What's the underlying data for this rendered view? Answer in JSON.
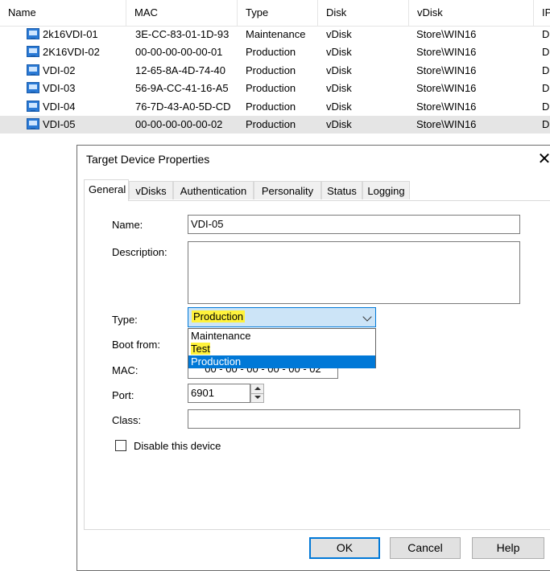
{
  "list": {
    "columns": [
      "Name",
      "MAC",
      "Type",
      "Disk",
      "vDisk",
      "IP"
    ],
    "rows": [
      {
        "name": "2k16VDI-01",
        "mac": "3E-CC-83-01-1D-93",
        "type": "Maintenance",
        "disk": "vDisk",
        "vdisk": "Store\\WIN16",
        "ip": "D"
      },
      {
        "name": "2K16VDI-02",
        "mac": "00-00-00-00-00-01",
        "type": "Production",
        "disk": "vDisk",
        "vdisk": "Store\\WIN16",
        "ip": "D"
      },
      {
        "name": "VDI-02",
        "mac": "12-65-8A-4D-74-40",
        "type": "Production",
        "disk": "vDisk",
        "vdisk": "Store\\WIN16",
        "ip": "D"
      },
      {
        "name": "VDI-03",
        "mac": "56-9A-CC-41-16-A5",
        "type": "Production",
        "disk": "vDisk",
        "vdisk": "Store\\WIN16",
        "ip": "D"
      },
      {
        "name": "VDI-04",
        "mac": "76-7D-43-A0-5D-CD",
        "type": "Production",
        "disk": "vDisk",
        "vdisk": "Store\\WIN16",
        "ip": "D"
      },
      {
        "name": "VDI-05",
        "mac": "00-00-00-00-00-02",
        "type": "Production",
        "disk": "vDisk",
        "vdisk": "Store\\WIN16",
        "ip": "D"
      }
    ],
    "selected_row": "VDI-05",
    "row_icon": "device-icon"
  },
  "dialog": {
    "title": "Target Device Properties",
    "tabs": [
      "General",
      "vDisks",
      "Authentication",
      "Personality",
      "Status",
      "Logging"
    ],
    "active_tab": "General",
    "labels": {
      "name": "Name:",
      "description": "Description:",
      "type": "Type:",
      "boot_from": "Boot from:",
      "mac": "MAC:",
      "port": "Port:",
      "class": "Class:"
    },
    "values": {
      "name": "VDI-05",
      "description": "",
      "type": "Production",
      "mac": "00 - 00 - 00 - 00 - 00 - 02",
      "port": "6901",
      "class": ""
    },
    "type_options": [
      "Maintenance",
      "Test",
      "Production"
    ],
    "type_selected_option": "Production",
    "checkbox": {
      "label": "Disable this device",
      "checked": false
    },
    "buttons": {
      "ok": "OK",
      "cancel": "Cancel",
      "help": "Help"
    },
    "highlight_color": "#fff23c",
    "selection_color": "#0078d7"
  }
}
